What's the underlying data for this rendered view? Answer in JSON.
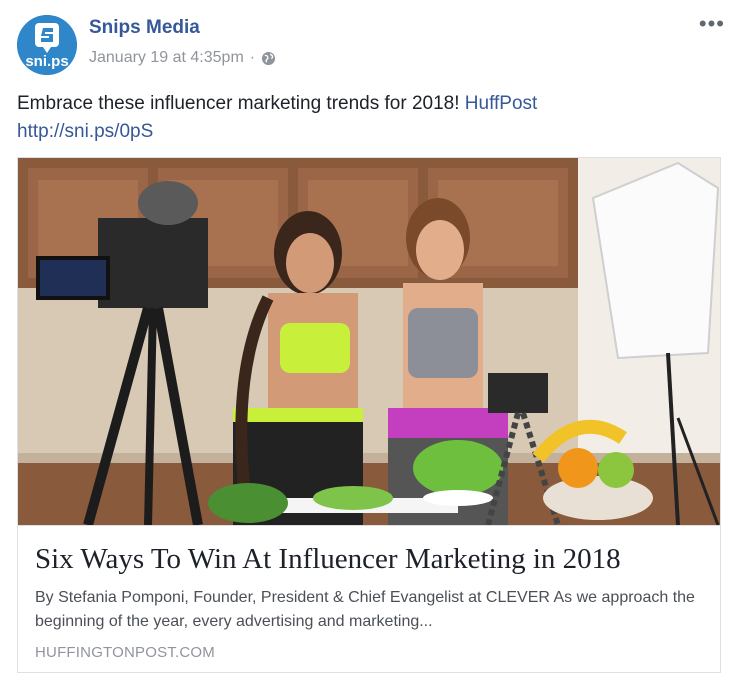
{
  "post": {
    "page_name": "Snips Media",
    "avatar_text": "sni.ps",
    "timestamp": "January 19 at 4:35pm",
    "separator": "·",
    "privacy_icon": "globe-icon",
    "more_icon": "more-options-icon",
    "more_label": "•••",
    "text_main": "Embrace these influencer marketing trends for 2018! ",
    "text_link": "HuffPost",
    "url": "http://sni.ps/0pS"
  },
  "link_preview": {
    "title": "Six Ways To Win At Influencer Marketing in 2018",
    "description": "By Stefania Pomponi, Founder, President & Chief Evangelist at CLEVER As we approach the beginning of the year, every advertising and marketing...",
    "domain": "HUFFINGTONPOST.COM"
  },
  "colors": {
    "link": "#365899",
    "meta": "#90949c",
    "avatar_bg": "#2f86c8"
  }
}
